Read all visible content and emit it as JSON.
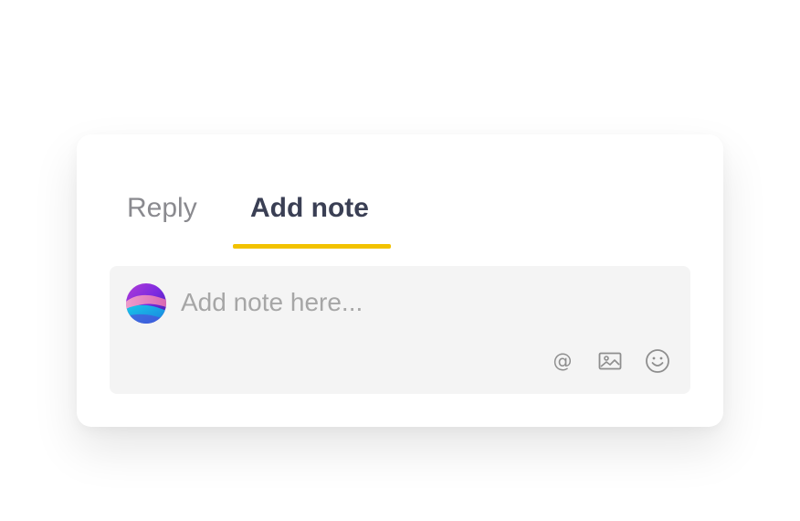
{
  "tabs": [
    {
      "label": "Reply",
      "active": false
    },
    {
      "label": "Add note",
      "active": true
    }
  ],
  "composer": {
    "placeholder": "Add note here...",
    "value": ""
  },
  "toolbar": {
    "mention_symbol": "@",
    "icons": [
      "at-mention-icon",
      "image-icon",
      "emoji-icon"
    ]
  },
  "colors": {
    "active_tab_underline": "#f2c200",
    "active_tab_text": "#3a3f54",
    "inactive_tab_text": "#8a8a8f",
    "composer_background": "#f4f4f4",
    "icon_color": "#8e8e8e"
  }
}
